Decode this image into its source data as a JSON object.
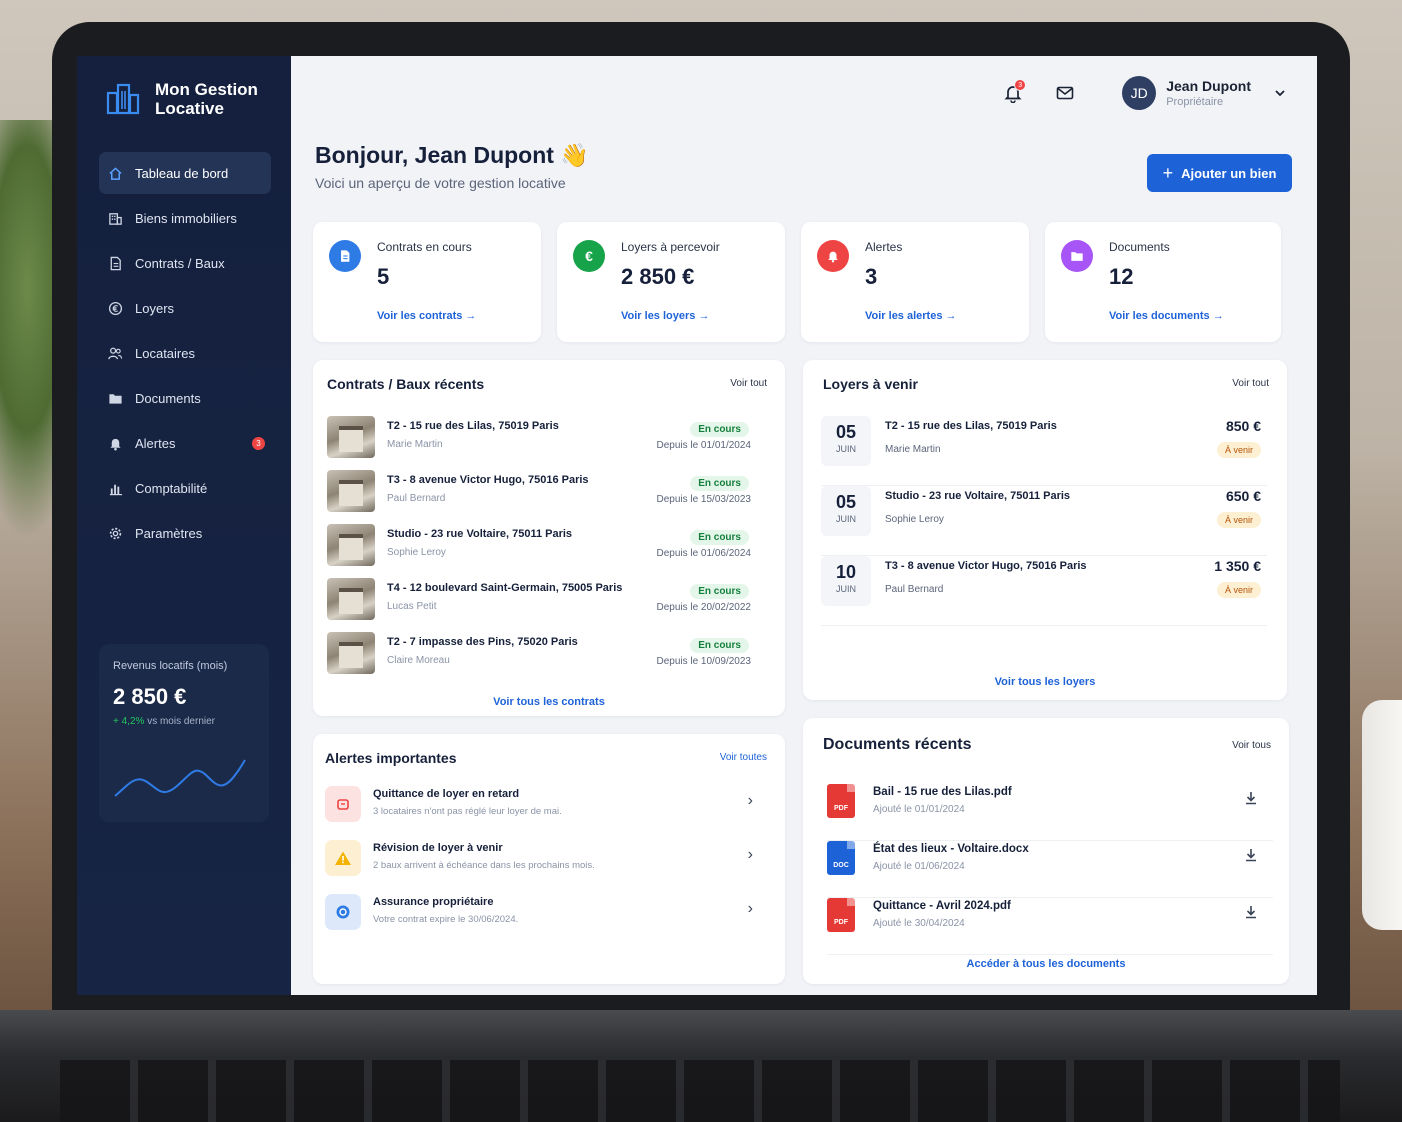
{
  "app": {
    "name": "Mon Gestion Locative"
  },
  "sidebar": {
    "items": [
      {
        "label": "Tableau de bord",
        "icon": "home-icon",
        "active": true
      },
      {
        "label": "Biens immobiliers",
        "icon": "building-icon"
      },
      {
        "label": "Contrats / Baux",
        "icon": "document-icon"
      },
      {
        "label": "Loyers",
        "icon": "euro-icon"
      },
      {
        "label": "Locataires",
        "icon": "users-icon"
      },
      {
        "label": "Documents",
        "icon": "folder-icon"
      },
      {
        "label": "Alertes",
        "icon": "bell-icon",
        "badge": "3"
      },
      {
        "label": "Comptabilité",
        "icon": "chart-icon"
      },
      {
        "label": "Paramètres",
        "icon": "gear-icon"
      }
    ],
    "revenue": {
      "label": "Revenus locatifs (mois)",
      "value": "2 850 €",
      "trend": "+ 4,2%",
      "trend_suffix": "vs mois dernier"
    }
  },
  "header": {
    "notifications_count": "3",
    "user": {
      "initials": "JD",
      "name": "Jean Dupont",
      "role": "Propriétaire"
    }
  },
  "greeting": {
    "title": "Bonjour, Jean Dupont 👋",
    "subtitle": "Voici un aperçu de votre gestion locative",
    "add_button": "Ajouter un bien"
  },
  "stats": [
    {
      "label": "Contrats en cours",
      "value": "5",
      "link": "Voir les contrats →",
      "color": "#2f7be6",
      "icon": "document-icon"
    },
    {
      "label": "Loyers à percevoir",
      "value": "2 850 €",
      "link": "Voir les loyers →",
      "color": "#16a34a",
      "icon": "euro-icon"
    },
    {
      "label": "Alertes",
      "value": "3",
      "link": "Voir les alertes →",
      "color": "#ef4444",
      "icon": "bell-icon"
    },
    {
      "label": "Documents",
      "value": "12",
      "link": "Voir les documents →",
      "color": "#a855f7",
      "icon": "folder-icon"
    }
  ],
  "contracts": {
    "title": "Contrats / Baux récents",
    "link": "Voir tout",
    "footer": "Voir tous les contrats",
    "rows": [
      {
        "title": "T2 - 15 rue des Lilas, 75019 Paris",
        "tenant": "Marie Martin",
        "status": "En cours",
        "since": "Depuis le 01/01/2024"
      },
      {
        "title": "T3 - 8 avenue Victor Hugo, 75016 Paris",
        "tenant": "Paul Bernard",
        "status": "En cours",
        "since": "Depuis le 15/03/2023"
      },
      {
        "title": "Studio - 23 rue Voltaire, 75011 Paris",
        "tenant": "Sophie Leroy",
        "status": "En cours",
        "since": "Depuis le 01/06/2024"
      },
      {
        "title": "T4 - 12 boulevard Saint-Germain, 75005 Paris",
        "tenant": "Lucas Petit",
        "status": "En cours",
        "since": "Depuis le 20/02/2022"
      },
      {
        "title": "T2 - 7 impasse des Pins, 75020 Paris",
        "tenant": "Claire Moreau",
        "status": "En cours",
        "since": "Depuis le 10/09/2023"
      }
    ]
  },
  "rents": {
    "title": "Loyers à venir",
    "link": "Voir tout",
    "footer": "Voir tous les loyers",
    "rows": [
      {
        "day": "05",
        "month": "JUIN",
        "title": "T2 - 15 rue des Lilas, 75019 Paris",
        "tenant": "Marie Martin",
        "amount": "850 €",
        "status": "À venir"
      },
      {
        "day": "05",
        "month": "JUIN",
        "title": "Studio - 23 rue Voltaire, 75011 Paris",
        "tenant": "Sophie Leroy",
        "amount": "650 €",
        "status": "À venir"
      },
      {
        "day": "10",
        "month": "JUIN",
        "title": "T3 - 8 avenue Victor Hugo, 75016 Paris",
        "tenant": "Paul Bernard",
        "amount": "1 350 €",
        "status": "À venir"
      }
    ]
  },
  "alerts": {
    "title": "Alertes importantes",
    "link": "Voir toutes",
    "rows": [
      {
        "title": "Quittance de loyer en retard",
        "desc": "3 locataires n'ont pas réglé leur loyer de mai.",
        "color": "#fde2e2",
        "fg": "#ef4444",
        "icon": "receipt-icon"
      },
      {
        "title": "Révision de loyer à venir",
        "desc": "2 baux arrivent à échéance dans les prochains mois.",
        "color": "#fdf0d2",
        "fg": "#d97706",
        "icon": "warning-icon"
      },
      {
        "title": "Assurance propriétaire",
        "desc": "Votre contrat expire le 30/06/2024.",
        "color": "#dde9fb",
        "fg": "#2f7be6",
        "icon": "shield-icon"
      }
    ]
  },
  "documents": {
    "title": "Documents récents",
    "link": "Voir tous",
    "footer": "Accéder à tous les documents",
    "rows": [
      {
        "name": "Bail - 15 rue des Lilas.pdf",
        "added": "Ajouté le 01/01/2024",
        "type": "PDF",
        "color": "#e53935"
      },
      {
        "name": "État des lieux - Voltaire.docx",
        "added": "Ajouté le 01/06/2024",
        "type": "DOC",
        "color": "#1e62d8"
      },
      {
        "name": "Quittance - Avril 2024.pdf",
        "added": "Ajouté le 30/04/2024",
        "type": "PDF",
        "color": "#e53935"
      }
    ]
  }
}
